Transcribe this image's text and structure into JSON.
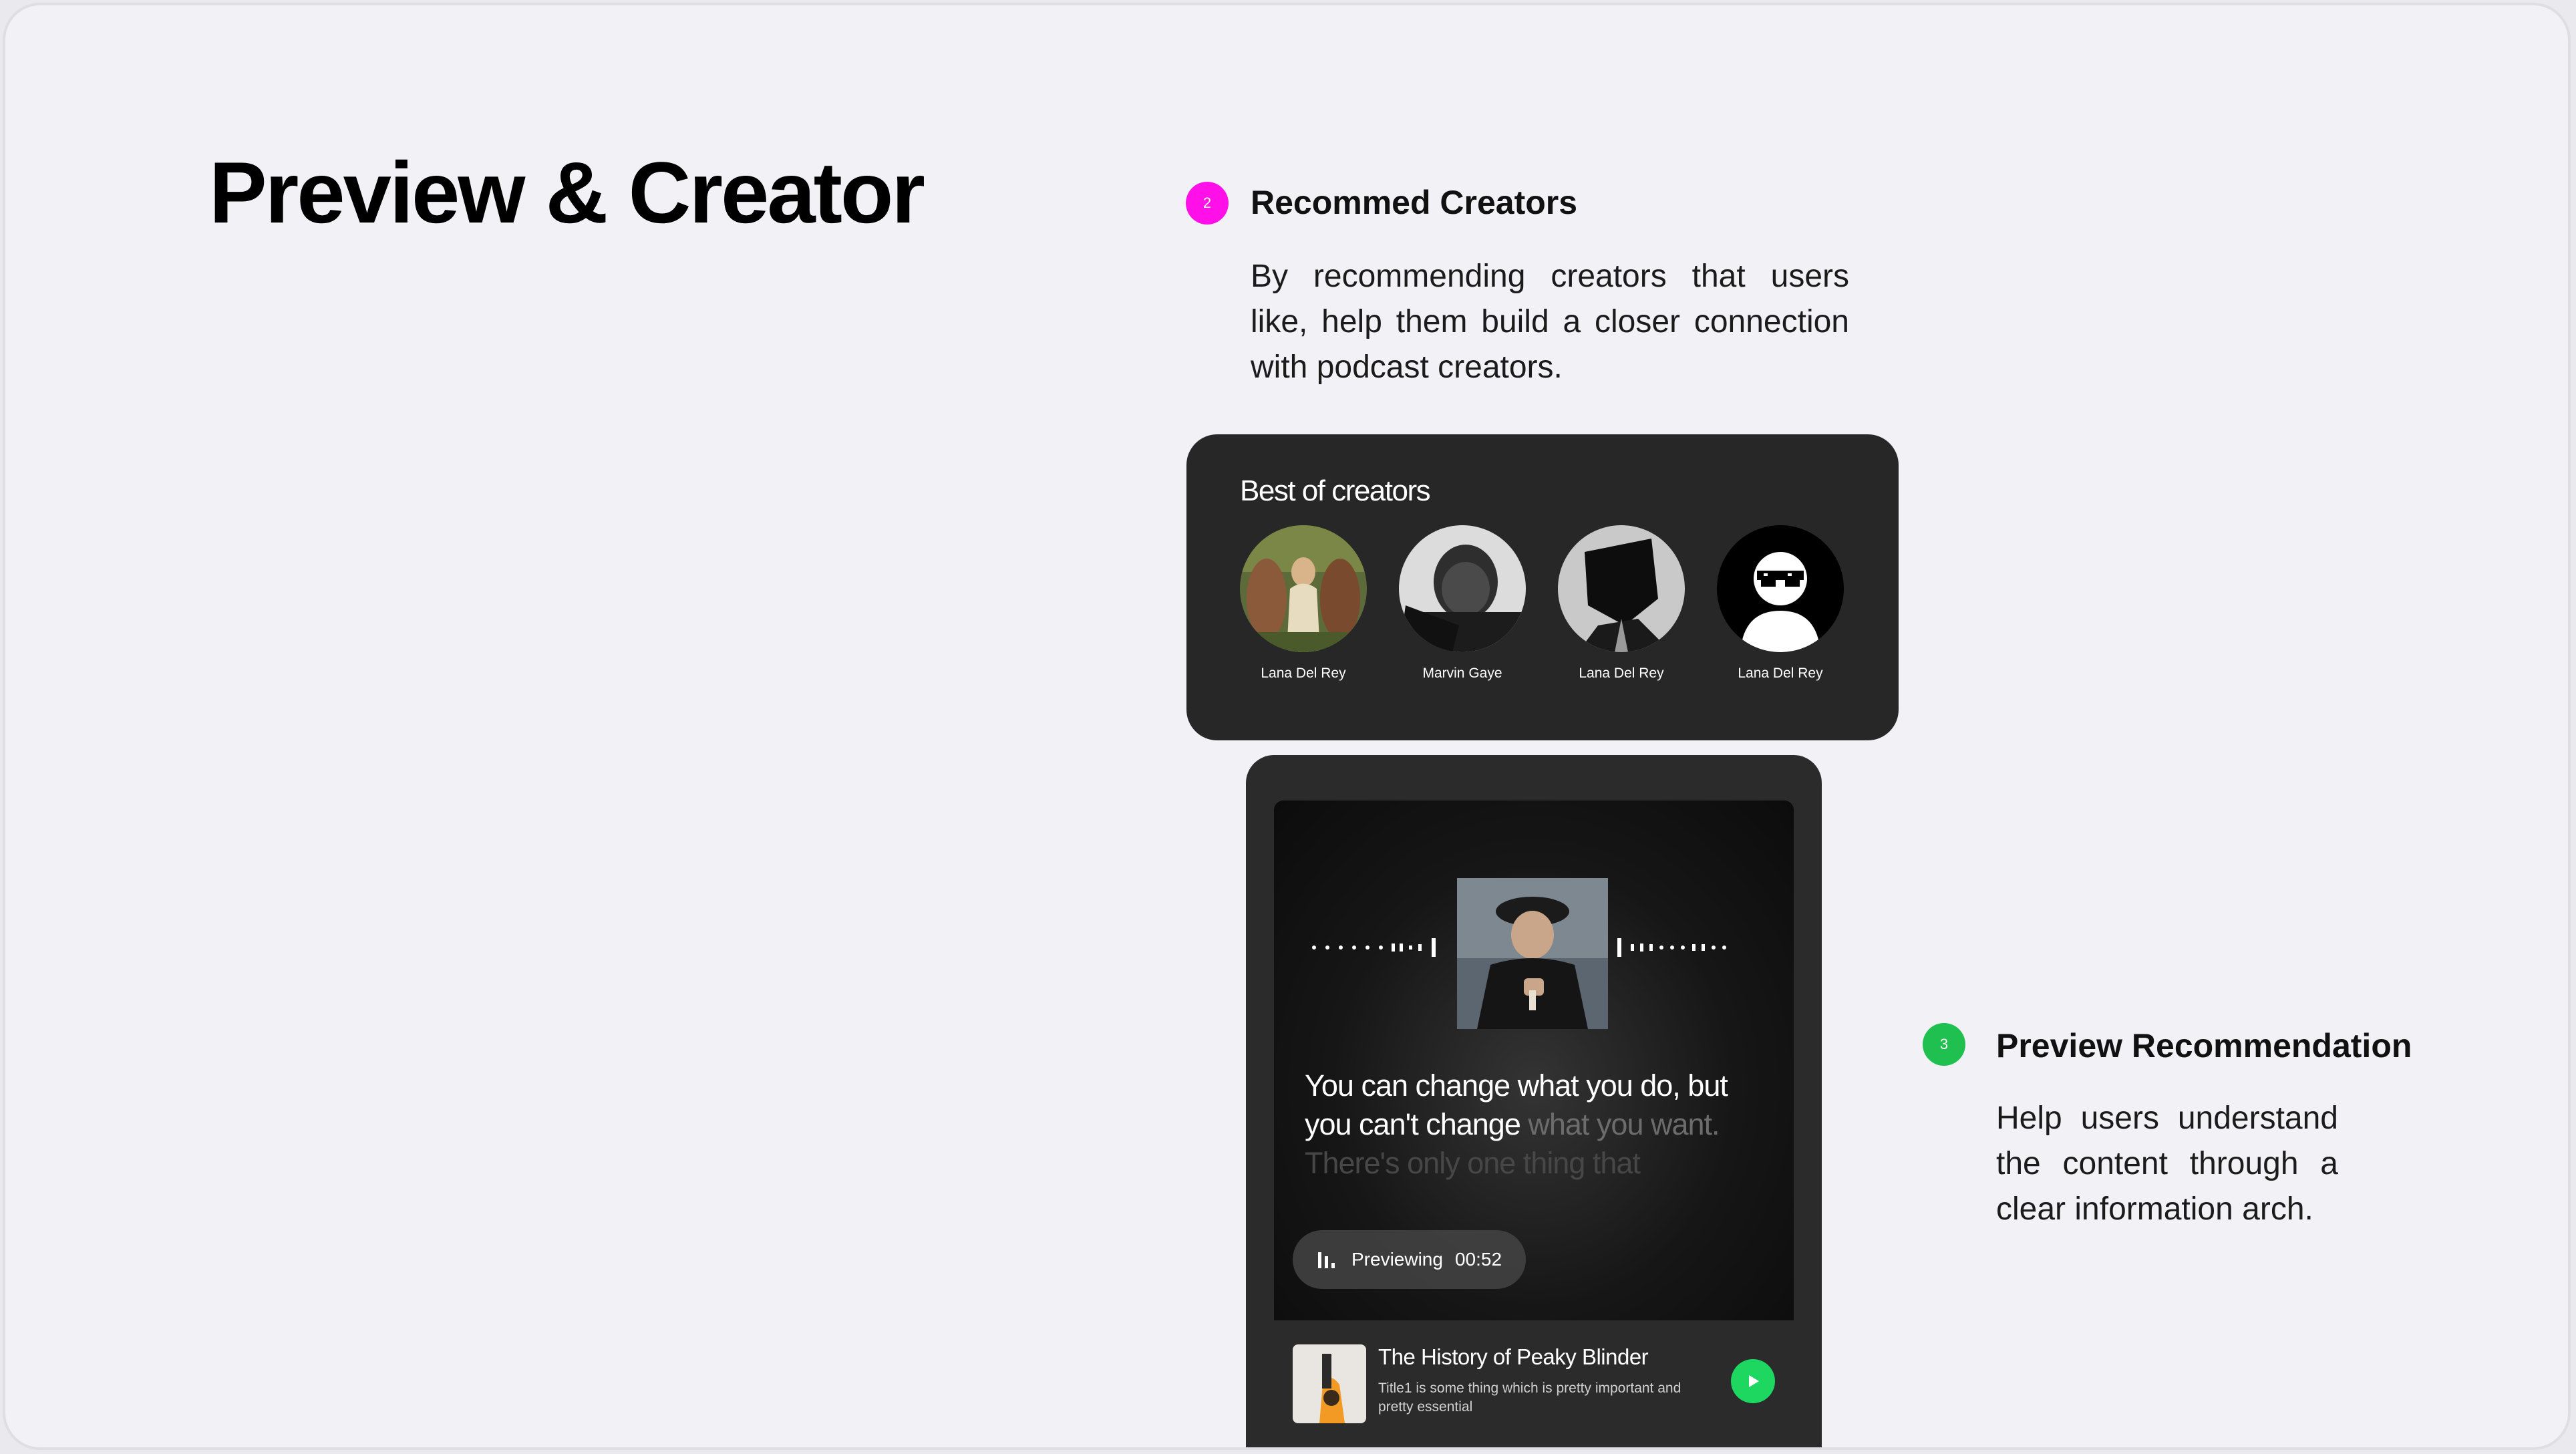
{
  "page": {
    "title": "Preview & Creator"
  },
  "sections": {
    "creators": {
      "step": "2",
      "heading": "Recommed Creators",
      "body": "By recommending creators that users like, help them build a closer connection with podcast creators.",
      "dot_color": "#ff10e8"
    },
    "preview": {
      "step": "3",
      "heading": "Preview Recommendation",
      "body": "Help users understand the content through a clear information arch.",
      "dot_color": "#1fbf50"
    }
  },
  "creators_card": {
    "title": "Best of creators",
    "creators": [
      {
        "name": "Lana Del Rey",
        "avatar": "photo-garden"
      },
      {
        "name": "Marvin Gaye",
        "avatar": "photo-bw-man"
      },
      {
        "name": "Lana Del Rey",
        "avatar": "photo-mask"
      },
      {
        "name": "Lana Del Rey",
        "avatar": "cool-avatar-icon"
      }
    ]
  },
  "preview_card": {
    "quote_bright": "You can change what you do, but you can't change",
    "quote_dim": "what you want.",
    "quote_faint": "There's only one thing that",
    "status_label": "Previewing",
    "status_time": "00:52",
    "episode": {
      "title": "The History of Peaky Blinder",
      "description": "Title1 is some thing which is pretty important and  pretty essential"
    },
    "accent_color": "#1ed760"
  }
}
